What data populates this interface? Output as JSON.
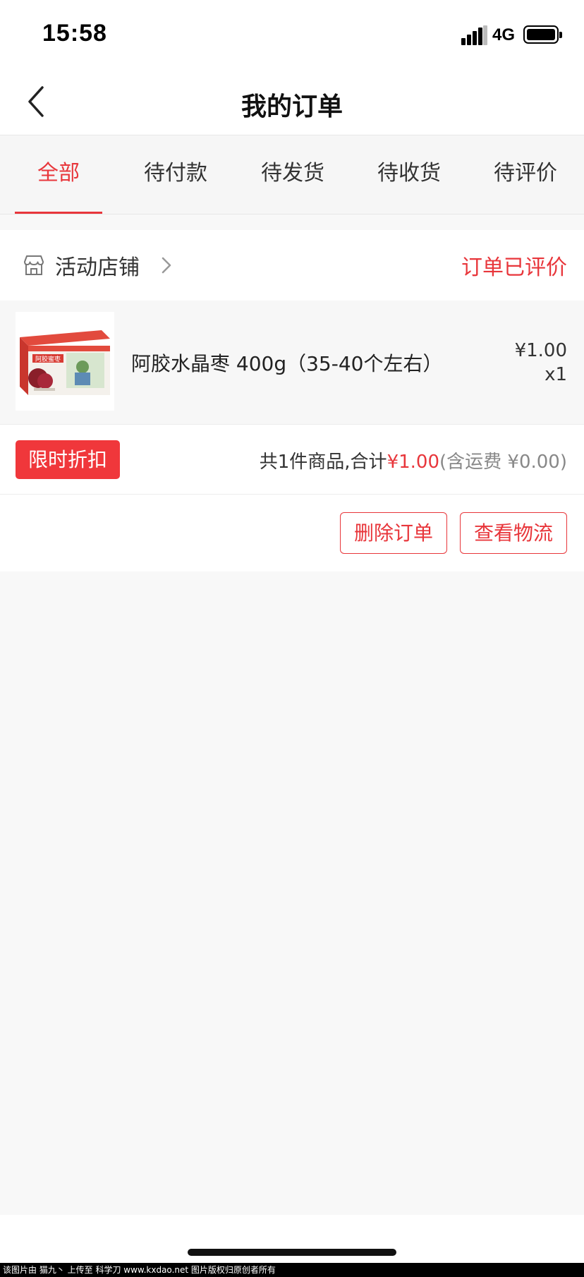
{
  "status_bar": {
    "time": "15:58",
    "network": "4G"
  },
  "header": {
    "title": "我的订单"
  },
  "tabs": [
    {
      "label": "全部",
      "active": true
    },
    {
      "label": "待付款",
      "active": false
    },
    {
      "label": "待发货",
      "active": false
    },
    {
      "label": "待收货",
      "active": false
    },
    {
      "label": "待评价",
      "active": false
    }
  ],
  "order": {
    "shop_name": "活动店铺",
    "status": "订单已评价",
    "product": {
      "name": "阿胶水晶枣 400g（35-40个左右）",
      "price": "¥1.00",
      "quantity": "x1",
      "image_label": "阿胶蜜枣"
    },
    "promo_badge": "限时折扣",
    "summary": {
      "prefix": "共1件商品,合计",
      "total": "¥1.00",
      "shipping": "(含运费 ¥0.00)"
    },
    "actions": {
      "delete_label": "删除订单",
      "logistics_label": "查看物流"
    }
  },
  "watermark": "该图片由 猫九丶 上传至 科学刀 www.kxdao.net 图片版权归原创者所有",
  "colors": {
    "accent": "#e8363b",
    "badge": "#f0373b"
  }
}
